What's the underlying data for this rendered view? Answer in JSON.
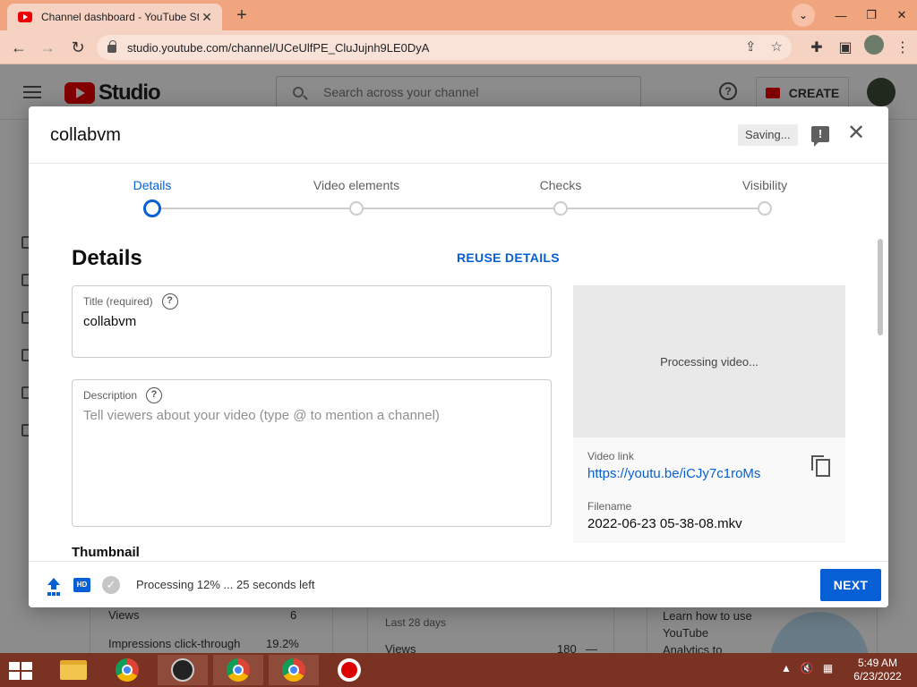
{
  "browser": {
    "tab_title": "Channel dashboard - YouTube Studio",
    "tab_close": "✕",
    "new_tab": "+",
    "url": "studio.youtube.com/channel/UCeUlfPE_CluJujnh9LE0DyA"
  },
  "studio": {
    "logo_text": "Studio",
    "search_placeholder": "Search across your channel",
    "create_label": "CREATE",
    "help_glyph": "?",
    "bg": {
      "views_label": "Views",
      "views_value": "6",
      "impressions_label": "Impressions click-through",
      "impressions_value": "19.2%",
      "last28": "Last 28 days",
      "views2_label": "Views",
      "views2_value": "180",
      "views2_dash": "—",
      "learn_line1": "Learn how to use",
      "learn_line2": "YouTube",
      "learn_line3": "Analytics to"
    }
  },
  "dialog": {
    "title": "collabvm",
    "saving_label": "Saving...",
    "feedback_glyph": "!",
    "close_glyph": "✕",
    "steps": [
      {
        "label": "Details",
        "active": true
      },
      {
        "label": "Video elements",
        "active": false
      },
      {
        "label": "Checks",
        "active": false
      },
      {
        "label": "Visibility",
        "active": false
      }
    ],
    "section_heading": "Details",
    "reuse_label": "REUSE DETAILS",
    "title_field": {
      "label": "Title (required)",
      "value": "collabvm"
    },
    "description_field": {
      "label": "Description",
      "placeholder": "Tell viewers about your video (type @ to mention a channel)"
    },
    "thumbnail_heading": "Thumbnail",
    "preview": {
      "processing_text": "Processing video...",
      "video_link_label": "Video link",
      "video_link": "https://youtu.be/iCJy7c1roMs",
      "filename_label": "Filename",
      "filename": "2022-06-23 05-38-08.mkv"
    },
    "footer": {
      "hd_badge": "HD",
      "check_glyph": "✓",
      "progress_text": "Processing 12% ... 25 seconds left",
      "next_label": "NEXT"
    }
  },
  "taskbar": {
    "time": "5:49 AM",
    "date": "6/23/2022"
  }
}
